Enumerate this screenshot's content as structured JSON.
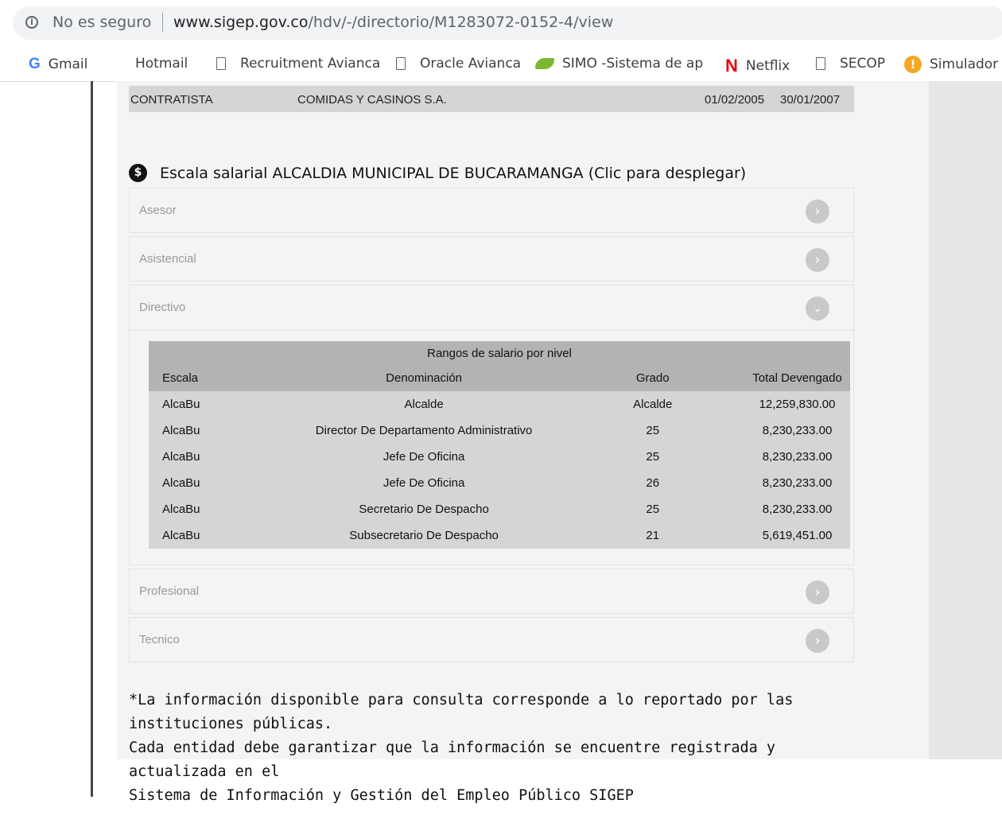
{
  "browser": {
    "security_label": "No es seguro",
    "url_host": "www.sigep.gov.co",
    "url_path": "/hdv/-/directorio/M1283072-0152-4/view",
    "bookmarks": [
      {
        "label": "Gmail",
        "icon": "google-icon"
      },
      {
        "label": "Hotmail",
        "icon": "microsoft-icon"
      },
      {
        "label": "Recruitment Avianca",
        "icon": "page-icon"
      },
      {
        "label": "Oracle Avianca",
        "icon": "page-icon"
      },
      {
        "label": "SIMO -Sistema de ap",
        "icon": "leaf-icon"
      },
      {
        "label": "Netflix",
        "icon": "netflix-icon"
      },
      {
        "label": "SECOP",
        "icon": "page-icon"
      },
      {
        "label": "Simulador",
        "icon": "simulador-icon"
      }
    ]
  },
  "contract": {
    "type": "CONTRATISTA",
    "entity": "COMIDAS Y CASINOS S.A.",
    "start": "01/02/2005",
    "end": "30/01/2007"
  },
  "scale": {
    "icon_label": "$",
    "title": "Escala salarial ALCALDIA MUNICIPAL DE BUCARAMANGA (Clic para desplegar)",
    "levels": [
      {
        "label": "Asesor",
        "expanded": false
      },
      {
        "label": "Asistencial",
        "expanded": false
      },
      {
        "label": "Directivo",
        "expanded": true
      },
      {
        "label": "Profesional",
        "expanded": false
      },
      {
        "label": "Tecnico",
        "expanded": false
      }
    ],
    "table": {
      "caption": "Rangos de salario por nivel",
      "headers": [
        "Escala",
        "Denominación",
        "Grado",
        "Total Devengado"
      ],
      "rows": [
        [
          "AlcaBu",
          "Alcalde",
          "Alcalde",
          "12,259,830.00"
        ],
        [
          "AlcaBu",
          "Director De Departamento Administrativo",
          "25",
          "8,230,233.00"
        ],
        [
          "AlcaBu",
          "Jefe De Oficina",
          "25",
          "8,230,233.00"
        ],
        [
          "AlcaBu",
          "Jefe De Oficina",
          "26",
          "8,230,233.00"
        ],
        [
          "AlcaBu",
          "Secretario De Despacho",
          "25",
          "8,230,233.00"
        ],
        [
          "AlcaBu",
          "Subsecretario De Despacho",
          "21",
          "5,619,451.00"
        ]
      ]
    }
  },
  "footnote": {
    "line1": "*La información disponible para consulta corresponde a lo reportado por las instituciones públicas.",
    "line2": "Cada entidad debe garantizar que la información se encuentre registrada y actualizada en el",
    "line3": "Sistema de Información y Gestión del Empleo Público SIGEP"
  }
}
